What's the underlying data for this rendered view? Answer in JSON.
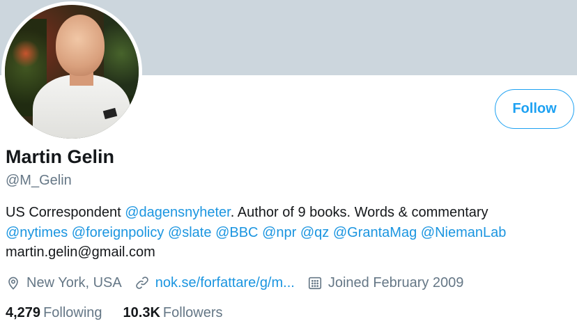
{
  "profile": {
    "name": "Martin Gelin",
    "handle": "@M_Gelin",
    "follow_label": "Follow",
    "bio": {
      "line1_prefix": "US Correspondent ",
      "line1_mention": "@dagensnyheter",
      "line1_suffix": ". Author of 9 books. Words & commentary",
      "mentions": [
        "@nytimes",
        "@foreignpolicy",
        "@slate",
        "@BBC",
        "@npr",
        "@qz",
        "@GrantaMag",
        "@NiemanLab"
      ],
      "email": "martin.gelin@gmail.com"
    },
    "location": "New York, USA",
    "website": "nok.se/forfattare/g/m...",
    "joined": "Joined February 2009",
    "following_count": "4,279",
    "following_label": "Following",
    "followers_count": "10.3K",
    "followers_label": "Followers"
  },
  "icons": {
    "location": "location-pin-icon",
    "link": "link-icon",
    "calendar": "calendar-icon"
  },
  "colors": {
    "accent": "#1da1f2",
    "link": "#1b95e0",
    "banner": "#ccd6dd",
    "secondary_text": "#657786"
  }
}
